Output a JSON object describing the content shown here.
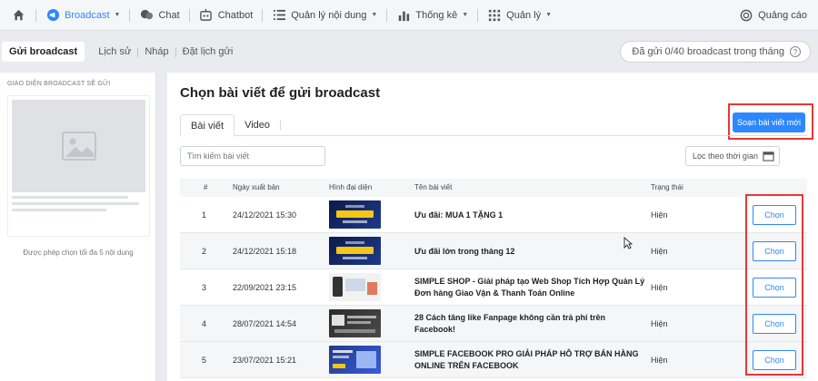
{
  "nav": {
    "home_icon": "home-icon",
    "items": [
      {
        "label": "Broadcast",
        "icon": "broadcast-icon",
        "active": true,
        "dropdown": true
      },
      {
        "label": "Chat",
        "icon": "chat-icon"
      },
      {
        "label": "Chatbot",
        "icon": "chatbot-icon"
      },
      {
        "label": "Quản lý nội dung",
        "icon": "list-icon",
        "dropdown": true
      },
      {
        "label": "Thống kê",
        "icon": "bar-chart-icon",
        "dropdown": true
      },
      {
        "label": "Quản lý",
        "icon": "grid-icon",
        "dropdown": true
      }
    ],
    "ads": {
      "label": "Quảng cáo",
      "icon": "ads-icon"
    }
  },
  "subnav": {
    "tabs": [
      "Gửi broadcast",
      "Lịch sử",
      "Nháp",
      "Đặt lịch gửi"
    ],
    "quota": "Đã gửi 0/40 broadcast trong tháng"
  },
  "preview": {
    "title": "GIAO DIỆN BROADCAST SẼ GỬI",
    "note": "Được phép chọn tối đa 5 nội dung"
  },
  "main": {
    "title": "Chọn bài viết để gửi broadcast",
    "new_post_button": "Soạn bài viết mới",
    "tabs": [
      "Bài viết",
      "Video"
    ],
    "search_placeholder": "Tìm kiếm bài viết",
    "date_filter": "Lọc theo thời gian",
    "table": {
      "headers": [
        "#",
        "Ngày xuất bản",
        "Hình đại diện",
        "Tên bài viết",
        "Trạng thái"
      ],
      "choose_label": "Chọn",
      "rows": [
        {
          "no": "1",
          "date": "24/12/2021 15:30",
          "name_1": "Ưu đãi: MUA 1 TẶNG 1",
          "name_2": "",
          "status": "Hiện"
        },
        {
          "no": "2",
          "date": "24/12/2021 15:18",
          "name_1": "Ưu đãi lớn trong tháng 12",
          "name_2": "",
          "status": "Hiện"
        },
        {
          "no": "3",
          "date": "22/09/2021 23:15",
          "name_1": "SIMPLE SHOP - Giải pháp tạo Web Shop Tích Hợp Quản Lý",
          "name_2": "Đơn hàng Giao Vận & Thanh Toán Online",
          "status": "Hiện"
        },
        {
          "no": "4",
          "date": "28/07/2021 14:54",
          "name_1": "28 Cách tăng like Fanpage không cần trả phí trên Facebook!",
          "name_2": "",
          "status": "Hiện"
        },
        {
          "no": "5",
          "date": "23/07/2021 15:21",
          "name_1": "SIMPLE FACEBOOK PRO GIẢI PHÁP HỖ TRỢ BÁN HÀNG",
          "name_2": "ONLINE TRÊN FACEBOOK",
          "status": "Hiện"
        }
      ]
    }
  },
  "colors": {
    "accent": "#2d88ff",
    "highlight": "#e53935"
  }
}
